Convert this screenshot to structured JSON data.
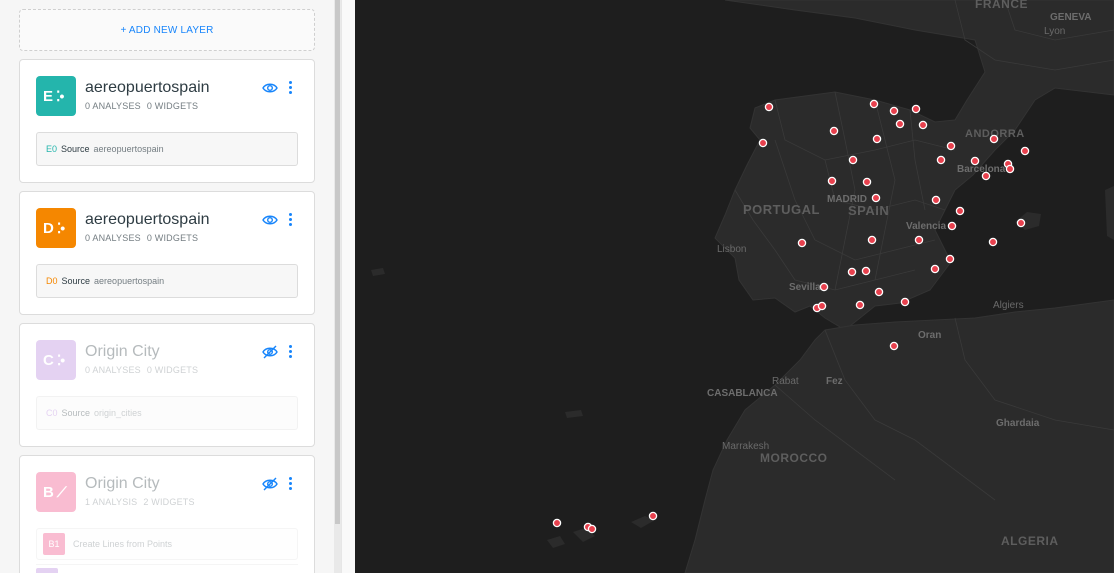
{
  "sidebar": {
    "add_layer_label": "+ ADD NEW LAYER",
    "layers": [
      {
        "letter": "E",
        "title": "aereopuertospain",
        "analyses": "0 ANALYSES",
        "widgets": "0 WIDGETS",
        "color": "#24b5ac",
        "visible": true,
        "node_id": "E0",
        "source_word": "Source",
        "source_name": "aereopuertospain"
      },
      {
        "letter": "D",
        "title": "aereopuertospain",
        "analyses": "0 ANALYSES",
        "widgets": "0 WIDGETS",
        "color": "#f58700",
        "visible": true,
        "node_id": "D0",
        "source_word": "Source",
        "source_name": "aereopuertospain"
      },
      {
        "letter": "C",
        "title": "Origin City",
        "analyses": "0 ANALYSES",
        "widgets": "0 WIDGETS",
        "color": "#b480dc",
        "visible": false,
        "node_id": "C0",
        "source_word": "Source",
        "source_name": "origin_cities"
      },
      {
        "letter": "B",
        "title": "Origin City",
        "analyses": "1 ANALYSIS",
        "widgets": "2 WIDGETS",
        "color": "#f0437d",
        "visible": false,
        "node_id": "B1",
        "analysis_label": "Create Lines from Points"
      }
    ]
  },
  "map": {
    "labels": {
      "france": "FRANCE",
      "geneva": "GENEVA",
      "lyon": "Lyon",
      "andorra": "ANDORRA",
      "barcelona": "Barcelona",
      "portugal": "PORTUGAL",
      "madrid": "MADRID",
      "spain": "SPAIN",
      "valencia": "Valencia",
      "lisbon": "Lisbon",
      "sevilla": "Sevilla",
      "algiers": "Algiers",
      "oran": "Oran",
      "rabat": "Rabat",
      "fez": "Fez",
      "casablanca": "CASABLANCA",
      "ghardaia": "Ghardaia",
      "marrakesh": "Marrakesh",
      "morocco": "MOROCCO",
      "algeria": "ALGERIA"
    },
    "point_color": "#e8414e"
  }
}
